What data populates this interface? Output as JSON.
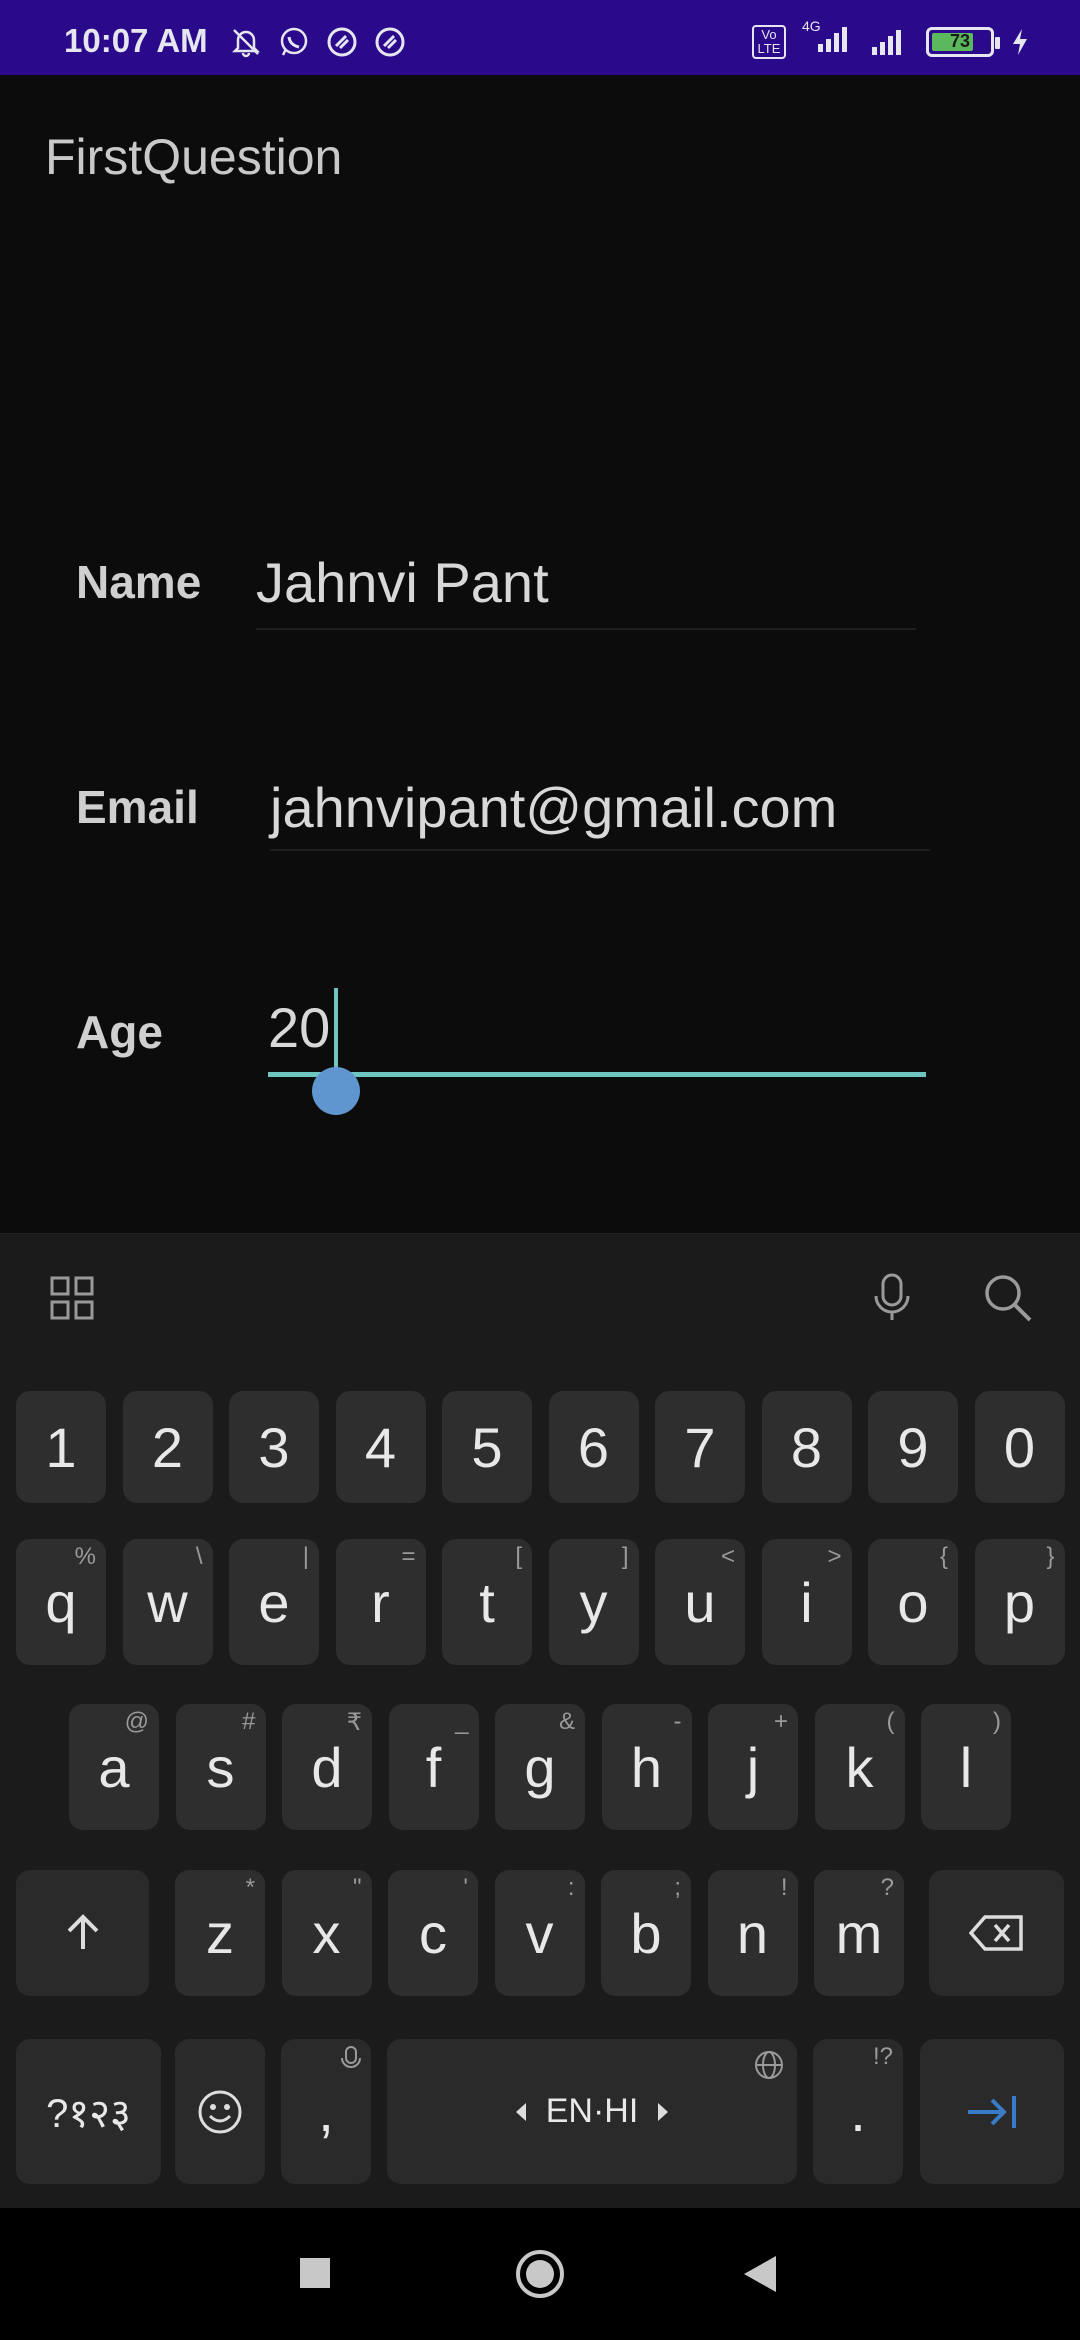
{
  "status_bar": {
    "time": "10:07 AM",
    "network": "4G",
    "volte": "Vo LTE",
    "battery": "73"
  },
  "app": {
    "title": "FirstQuestion"
  },
  "form": {
    "name_label": "Name",
    "name_value": "Jahnvi Pant",
    "email_label": "Email",
    "email_value": "jahnvipant@gmail.com",
    "age_label": "Age",
    "age_value": "20"
  },
  "keyboard": {
    "number_row": [
      "1",
      "2",
      "3",
      "4",
      "5",
      "6",
      "7",
      "8",
      "9",
      "0"
    ],
    "row1": [
      {
        "key": "q",
        "hint": "%"
      },
      {
        "key": "w",
        "hint": "\\"
      },
      {
        "key": "e",
        "hint": "|"
      },
      {
        "key": "r",
        "hint": "="
      },
      {
        "key": "t",
        "hint": "["
      },
      {
        "key": "y",
        "hint": "]"
      },
      {
        "key": "u",
        "hint": "<"
      },
      {
        "key": "i",
        "hint": ">"
      },
      {
        "key": "o",
        "hint": "{"
      },
      {
        "key": "p",
        "hint": "}"
      }
    ],
    "row2": [
      {
        "key": "a",
        "hint": "@"
      },
      {
        "key": "s",
        "hint": "#"
      },
      {
        "key": "d",
        "hint": "₹"
      },
      {
        "key": "f",
        "hint": "_"
      },
      {
        "key": "g",
        "hint": "&"
      },
      {
        "key": "h",
        "hint": "-"
      },
      {
        "key": "j",
        "hint": "+"
      },
      {
        "key": "k",
        "hint": "("
      },
      {
        "key": "l",
        "hint": ")"
      }
    ],
    "row3": [
      {
        "key": "z",
        "hint": "*"
      },
      {
        "key": "x",
        "hint": "\""
      },
      {
        "key": "c",
        "hint": "'"
      },
      {
        "key": "v",
        "hint": ":"
      },
      {
        "key": "b",
        "hint": ";"
      },
      {
        "key": "n",
        "hint": "!"
      },
      {
        "key": "m",
        "hint": "?"
      }
    ],
    "symbols_label": "?१२३",
    "comma": ",",
    "space_label": "EN·HI",
    "period": ".",
    "period_hint": "!?"
  }
}
